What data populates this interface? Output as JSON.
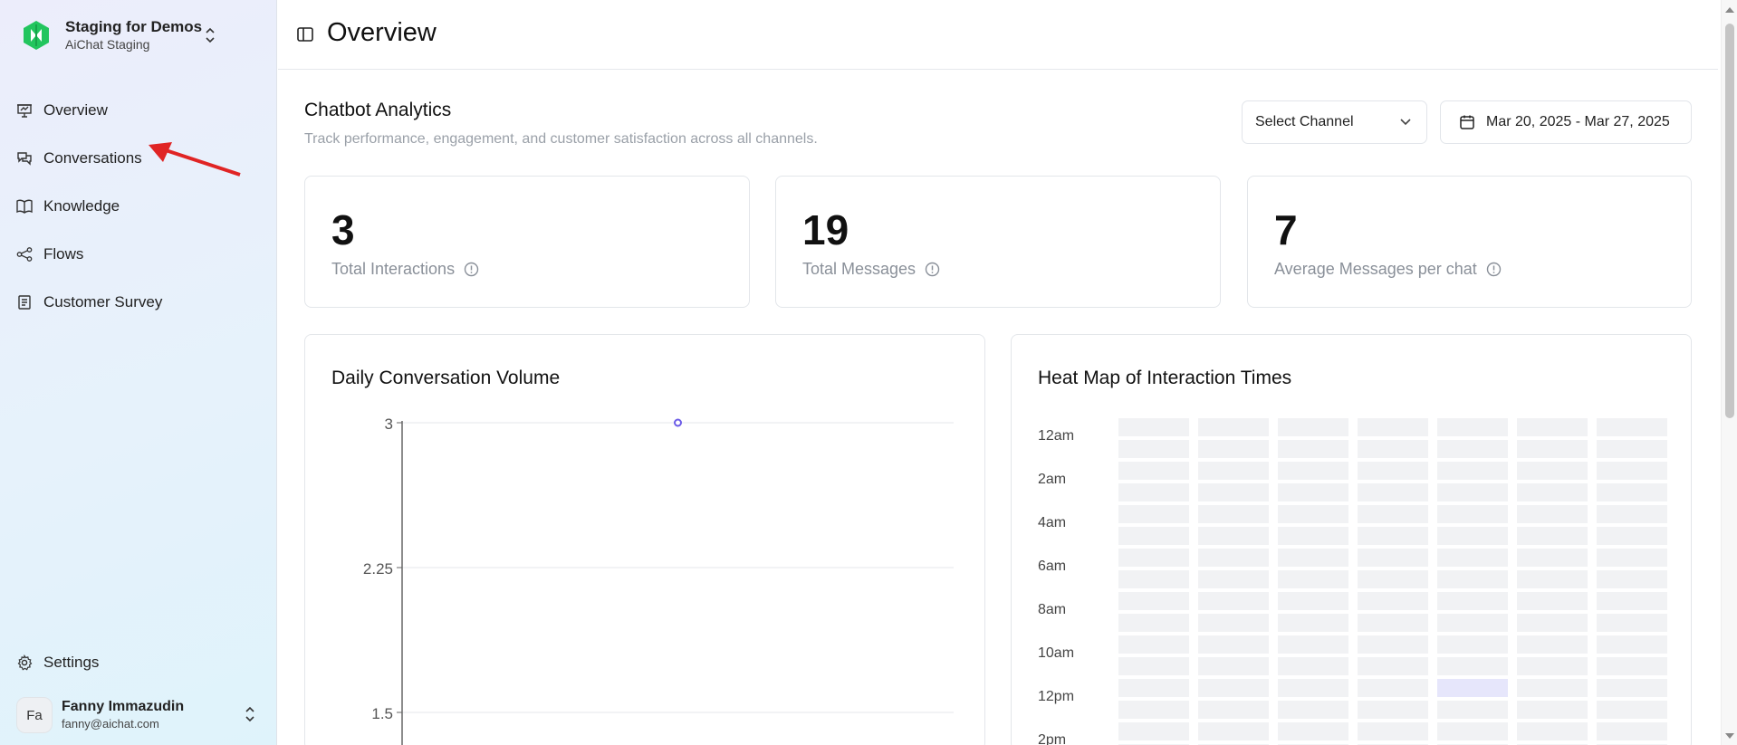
{
  "workspace": {
    "name": "Staging for Demos",
    "subtitle": "AiChat Staging"
  },
  "nav": {
    "items": [
      {
        "label": "Overview",
        "icon": "presentation-icon"
      },
      {
        "label": "Conversations",
        "icon": "chat-bubbles-icon"
      },
      {
        "label": "Knowledge",
        "icon": "book-icon"
      },
      {
        "label": "Flows",
        "icon": "workflow-icon"
      },
      {
        "label": "Customer Survey",
        "icon": "survey-icon"
      }
    ],
    "settings_label": "Settings"
  },
  "user": {
    "initials": "Fa",
    "name": "Fanny Immazudin",
    "email": "fanny@aichat.com"
  },
  "header": {
    "title": "Overview"
  },
  "analytics": {
    "title": "Chatbot Analytics",
    "subtitle": "Track performance, engagement, and customer satisfaction across all channels.",
    "channel_placeholder": "Select Channel",
    "date_range": "Mar 20, 2025 - Mar 27, 2025"
  },
  "stats": [
    {
      "value": "3",
      "label": "Total Interactions"
    },
    {
      "value": "19",
      "label": "Total Messages"
    },
    {
      "value": "7",
      "label": "Average Messages per chat"
    }
  ],
  "colors": {
    "accent": "#6c5ce7",
    "brand": "#22c55e",
    "annotation_arrow": "#e02424"
  },
  "charts": {
    "volume_title": "Daily Conversation Volume",
    "heatmap_title": "Heat Map of Interaction Times"
  },
  "chart_data": [
    {
      "type": "line",
      "title": "Daily Conversation Volume",
      "y_ticks": [
        "3",
        "2.25",
        "1.5"
      ],
      "ylim": [
        1.5,
        3
      ],
      "grid": true,
      "series": [
        {
          "points": [
            {
              "x_index": 0.5,
              "y": 3
            }
          ]
        }
      ]
    },
    {
      "type": "heatmap",
      "title": "Heat Map of Interaction Times",
      "row_labels": [
        "12am",
        "2am",
        "4am",
        "6am",
        "8am",
        "10am",
        "12pm",
        "2pm"
      ],
      "columns": 7,
      "rows_visible": 16,
      "highlighted_cells": [
        {
          "row": 12,
          "col": 4,
          "level": 1
        }
      ]
    }
  ]
}
